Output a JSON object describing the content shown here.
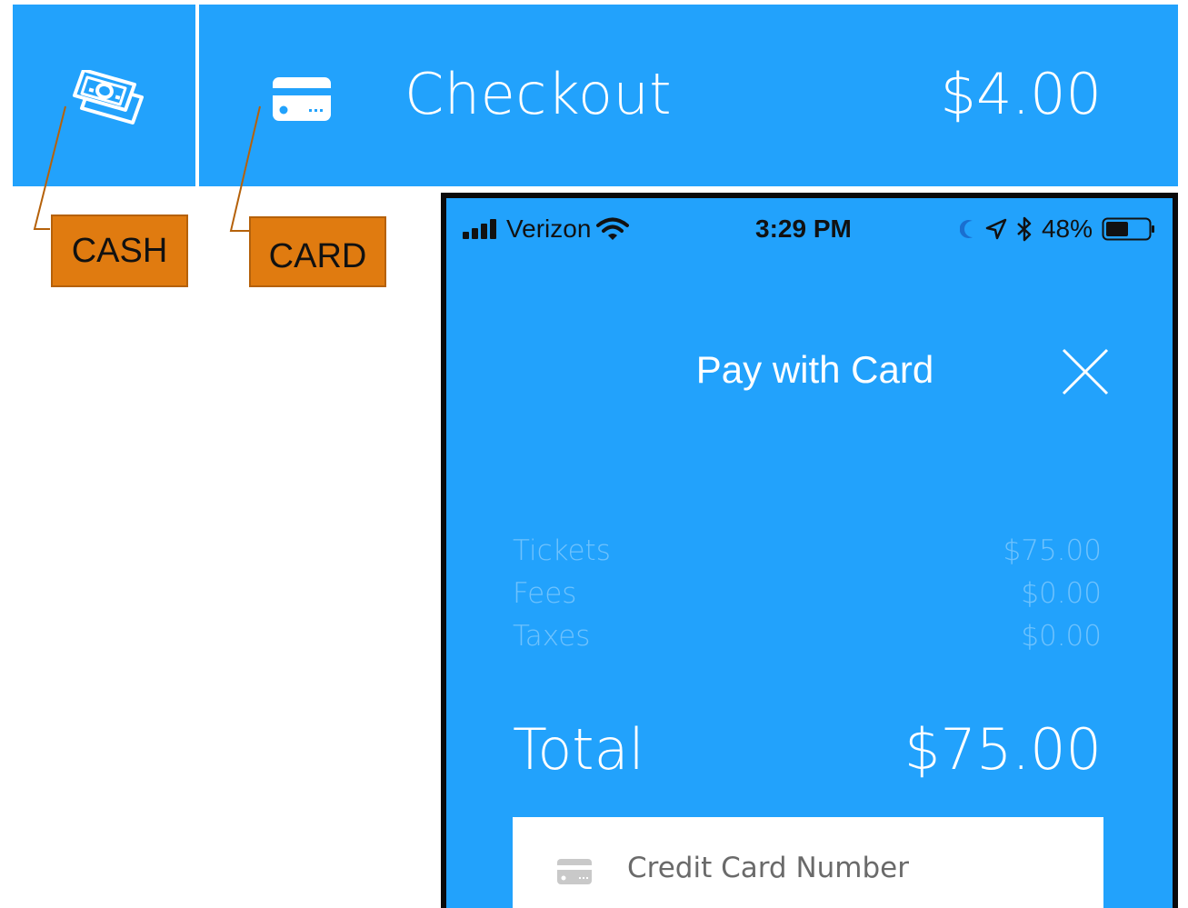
{
  "header": {
    "cash_icon": "cash-icon",
    "card_icon": "card-icon",
    "title": "Checkout",
    "amount": "$4.00",
    "bar_color": "#22a2fc"
  },
  "callouts": {
    "cash": "CASH",
    "card": "CARD",
    "color": "#e07b10"
  },
  "phone": {
    "status_bar": {
      "carrier": "Verizon",
      "time": "3:29 PM",
      "battery": "48%"
    },
    "title": "Pay with Card",
    "close_icon": "close-icon",
    "line_items": [
      {
        "label": "Tickets",
        "value": "$75.00"
      },
      {
        "label": "Fees",
        "value": "$0.00"
      },
      {
        "label": "Taxes",
        "value": "$0.00"
      }
    ],
    "total": {
      "label": "Total",
      "value": "$75.00"
    },
    "card_field": {
      "placeholder": "Credit Card Number",
      "icon": "card-icon"
    }
  }
}
